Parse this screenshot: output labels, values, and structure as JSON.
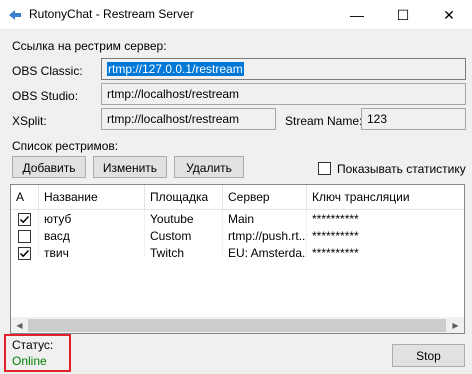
{
  "window": {
    "title": "RutonyChat - Restream Server",
    "minimize": "—",
    "maximize": "☐",
    "close": "✕"
  },
  "restream": {
    "group_label": "Ссылка на рестрим сервер:",
    "obs_classic_label": "OBS Classic:",
    "obs_classic_value": "rtmp://127.0.0.1/restream",
    "obs_studio_label": "OBS Studio:",
    "obs_studio_value": "rtmp://localhost/restream",
    "xsplit_label": "XSplit:",
    "xsplit_value": "rtmp://localhost/restream",
    "stream_name_label": "Stream Name:",
    "stream_name_value": "123"
  },
  "list_section": {
    "label": "Список рестримов:",
    "add_button": "Добавить",
    "edit_button": "Изменить",
    "delete_button": "Удалить",
    "show_stats_label": "Показывать статистику",
    "show_stats_checked": false
  },
  "table": {
    "columns": [
      "А",
      "Название",
      "Площадка",
      "Сервер",
      "Ключ трансляции"
    ],
    "rows": [
      {
        "active": true,
        "name": "ютуб",
        "platform": "Youtube",
        "server": "Main",
        "key": "**********"
      },
      {
        "active": false,
        "name": "васд",
        "platform": "Custom",
        "server": "rtmp://push.rt...",
        "key": "**********"
      },
      {
        "active": true,
        "name": "твич",
        "platform": "Twitch",
        "server": "EU: Amsterda...",
        "key": "**********"
      }
    ]
  },
  "status": {
    "label": "Статус:",
    "value": "Online",
    "value_color": "#008000"
  },
  "stop_button": "Stop",
  "colors": {
    "highlight_box": "#e0202a",
    "selection": "#0078d7"
  }
}
